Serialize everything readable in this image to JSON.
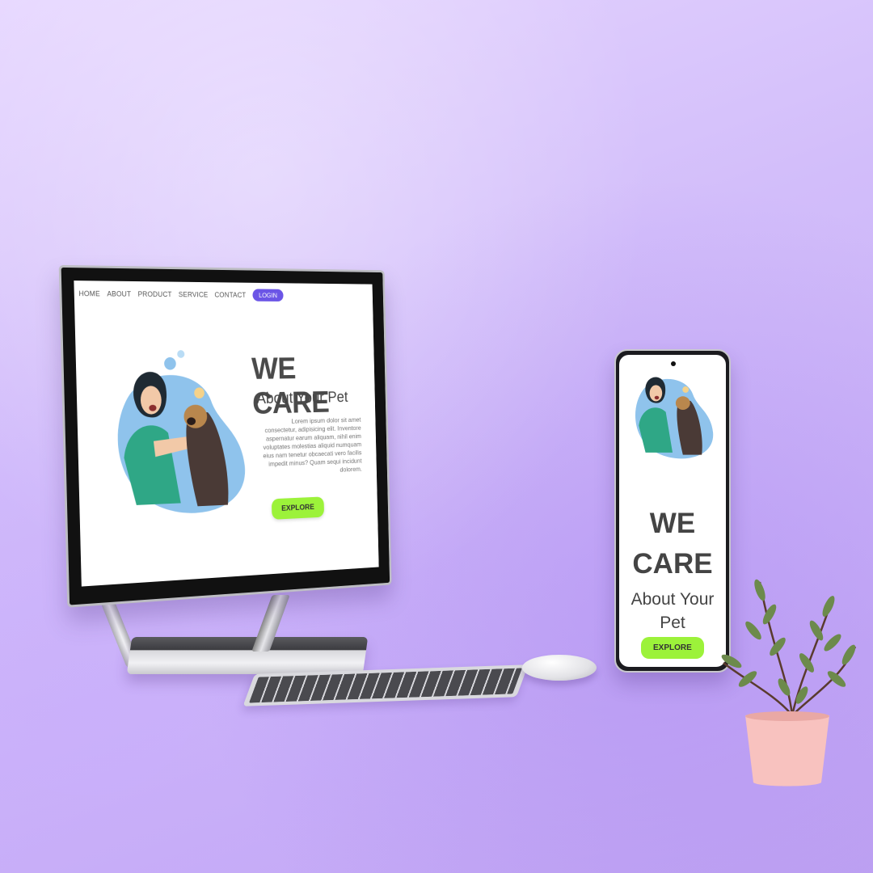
{
  "desktop": {
    "nav": [
      "HOME",
      "ABOUT",
      "PRODUCT",
      "SERVICE",
      "CONTACT"
    ],
    "login_label": "LOGIN",
    "headline": "WE CARE",
    "subheadline": "About Your Pet",
    "body_text": "Lorem ipsum dolor sit amet consectetur, adipisicing elit. Inventore aspernatur earum aliquam, nihil enim voluptates molestias aliquid numquam eius nam tenetur obcaecati vero facilis impedit minus? Quam sequi incidunt dolorem.",
    "explore_label": "EXPLORE"
  },
  "phone": {
    "headline_line1": "WE",
    "headline_line2": "CARE",
    "subheadline_line1": "About Your",
    "subheadline_line2": "Pet",
    "explore_label": "EXPLORE"
  },
  "colors": {
    "background": "#d2bdfa",
    "login_button": "#6b55e6",
    "explore_button": "#9cf23a",
    "illustration_blue": "#8fc3ec",
    "illustration_green": "#2fa786"
  },
  "icons": [
    "dog-icon",
    "woman-vet-icon",
    "plant-pot-icon"
  ]
}
